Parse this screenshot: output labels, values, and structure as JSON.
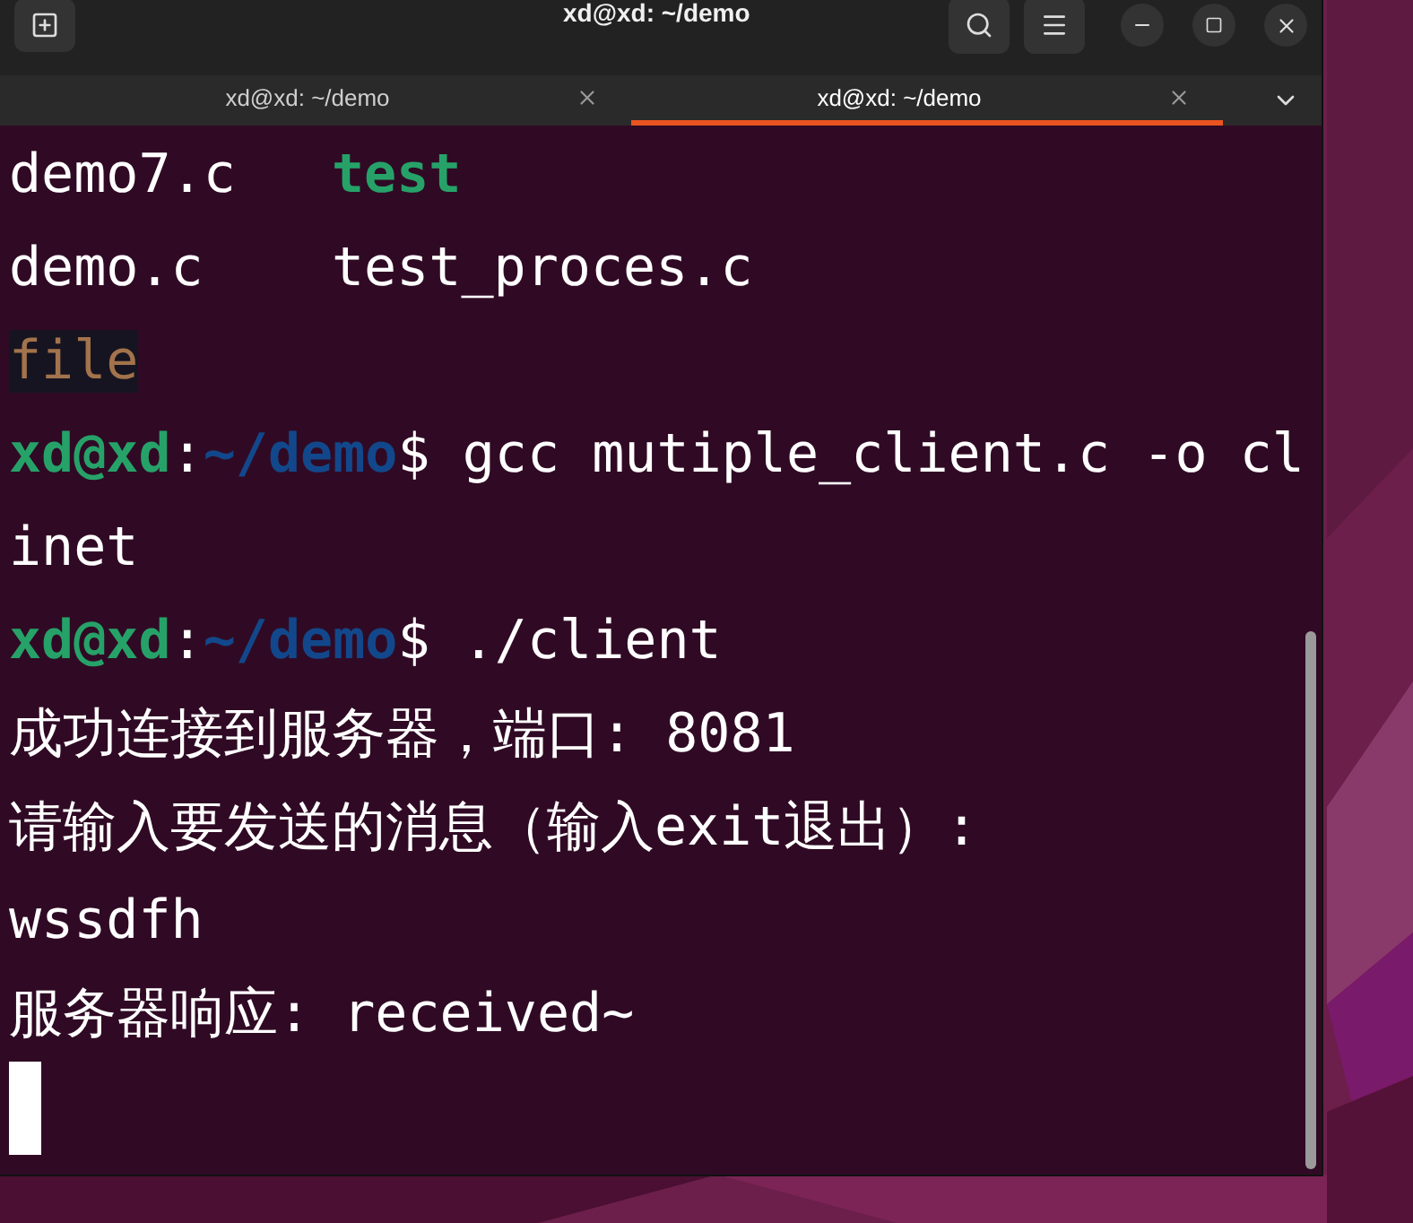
{
  "window": {
    "title": "xd@xd: ~/demo"
  },
  "tabs": [
    {
      "label": "xd@xd: ~/demo",
      "selected": false
    },
    {
      "label": "xd@xd: ~/demo",
      "selected": true
    }
  ],
  "terminal": {
    "lines": [
      {
        "kind": "ls",
        "items": [
          {
            "text": "demo7.c",
            "kind": "plain"
          },
          {
            "text": "test",
            "kind": "exec"
          }
        ]
      },
      {
        "kind": "ls",
        "items": [
          {
            "text": "demo.c",
            "kind": "plain"
          },
          {
            "text": "test_proces.c",
            "kind": "plain"
          }
        ]
      },
      {
        "kind": "ls",
        "items": [
          {
            "text": "file",
            "kind": "special"
          }
        ]
      },
      {
        "kind": "prompt",
        "segments": [
          {
            "text": "xd@xd",
            "kind": "user"
          },
          {
            "text": ":",
            "kind": "plain"
          },
          {
            "text": "~/demo",
            "kind": "path"
          },
          {
            "text": "$ gcc mutiple_client.c -o cl",
            "kind": "plain"
          }
        ]
      },
      {
        "kind": "output",
        "text": "inet"
      },
      {
        "kind": "prompt",
        "segments": [
          {
            "text": "xd@xd",
            "kind": "user"
          },
          {
            "text": ":",
            "kind": "plain"
          },
          {
            "text": "~/demo",
            "kind": "path"
          },
          {
            "text": "$ ./client",
            "kind": "plain"
          }
        ]
      },
      {
        "kind": "output",
        "text": "成功连接到服务器，端口: 8081"
      },
      {
        "kind": "output",
        "text": "请输入要发送的消息（输入exit退出）:"
      },
      {
        "kind": "output",
        "text": "wssdfh"
      },
      {
        "kind": "output",
        "text": "服务器响应: received~"
      },
      {
        "kind": "cursor"
      }
    ]
  }
}
